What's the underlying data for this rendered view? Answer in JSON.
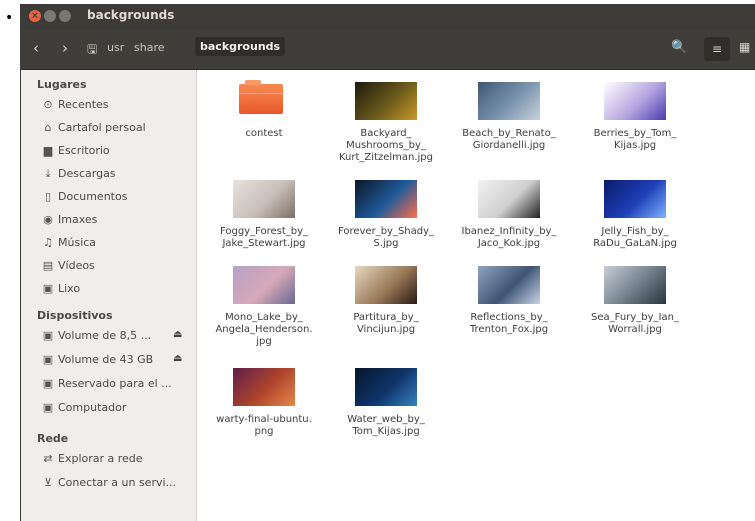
{
  "window": {
    "title": "backgrounds"
  },
  "toolbar": {
    "path": [
      "usr",
      "share",
      "backgrounds"
    ],
    "icons": {
      "back": "chevron-left",
      "forward": "chevron-right",
      "disk": "disk",
      "search": "search",
      "list": "list",
      "grid": "grid"
    }
  },
  "sidebar": {
    "lugares_heading": "Lugares",
    "lugares": [
      {
        "label": "Recentes",
        "icon": "clock"
      },
      {
        "label": "Cartafol persoal",
        "icon": "home"
      },
      {
        "label": "Escritorio",
        "icon": "desktop"
      },
      {
        "label": "Descargas",
        "icon": "download"
      },
      {
        "label": "Documentos",
        "icon": "document"
      },
      {
        "label": "Imaxes",
        "icon": "camera"
      },
      {
        "label": "Música",
        "icon": "music"
      },
      {
        "label": "Vídeos",
        "icon": "film"
      },
      {
        "label": "Lixo",
        "icon": "trash"
      }
    ],
    "dispositivos_heading": "Dispositivos",
    "dispositivos": [
      {
        "label": "Volume de 8,5 ...",
        "icon": "drive",
        "eject": true
      },
      {
        "label": "Volume de 43 GB",
        "icon": "drive",
        "eject": true
      },
      {
        "label": "Reservado para el ...",
        "icon": "drive",
        "eject": false
      },
      {
        "label": "Computador",
        "icon": "drive",
        "eject": false
      }
    ],
    "rede_heading": "Rede",
    "rede": [
      {
        "label": "Explorar a rede",
        "icon": "network"
      },
      {
        "label": "Conectar a un servi...",
        "icon": "server"
      }
    ]
  },
  "files": [
    {
      "name": "contest",
      "kind": "folder"
    },
    {
      "name": "Backyard_\nMushrooms_by_\nKurt_Zitzelman.jpg",
      "kind": "image",
      "colors": [
        "#1d1a10",
        "#6a5a1a",
        "#c89a2a"
      ]
    },
    {
      "name": "Beach_by_Renato_\nGiordanelli.jpg",
      "kind": "image",
      "colors": [
        "#3d5876",
        "#7c95ad",
        "#c6d2de"
      ]
    },
    {
      "name": "Berries_by_Tom_\nKijas.jpg",
      "kind": "image",
      "colors": [
        "#ffffff",
        "#b7a7e0",
        "#4a3ab0"
      ]
    },
    {
      "name": "Foggy_Forest_by_\nJake_Stewart.jpg",
      "kind": "image",
      "colors": [
        "#e6e2de",
        "#c9bfb8",
        "#7d6f67"
      ]
    },
    {
      "name": "Forever_by_Shady_\nS.jpg",
      "kind": "image",
      "colors": [
        "#0d1628",
        "#1f5a9a",
        "#ff6f4a"
      ]
    },
    {
      "name": "Ibanez_Infinity_by_\nJaco_Kok.jpg",
      "kind": "image",
      "colors": [
        "#f2f2f2",
        "#cfcfcf",
        "#202020"
      ]
    },
    {
      "name": "Jelly_Fish_by_\nRaDu_GaLaN.jpg",
      "kind": "image",
      "colors": [
        "#0a1b6a",
        "#1e3fb8",
        "#7fb3ff"
      ]
    },
    {
      "name": "Mono_Lake_by_\nAngela_Henderson.\njpg",
      "kind": "image",
      "colors": [
        "#b7a0c8",
        "#d7a8b8",
        "#6a6a92"
      ]
    },
    {
      "name": "Partitura_by_\nVincijun.jpg",
      "kind": "image",
      "colors": [
        "#e6d8c4",
        "#9b7a58",
        "#2a1a10"
      ]
    },
    {
      "name": "Reflections_by_\nTrenton_Fox.jpg",
      "kind": "image",
      "colors": [
        "#8fa3c0",
        "#3f5475",
        "#c8d4e6"
      ]
    },
    {
      "name": "Sea_Fury_by_Ian_\nWorrall.jpg",
      "kind": "image",
      "colors": [
        "#c6ced6",
        "#6f7c88",
        "#283440"
      ]
    },
    {
      "name": "warty-final-ubuntu.\npng",
      "kind": "image",
      "colors": [
        "#5e1f4a",
        "#b0442c",
        "#e7874b"
      ]
    },
    {
      "name": "Water_web_by_\nTom_Kijas.jpg",
      "kind": "image",
      "colors": [
        "#06142c",
        "#10366a",
        "#3c7fc4"
      ]
    }
  ],
  "accent_colors": {
    "titlebar": "#3c3b37",
    "close": "#e8633d",
    "folder": "#f07240",
    "sidebar": "#efeeec"
  }
}
